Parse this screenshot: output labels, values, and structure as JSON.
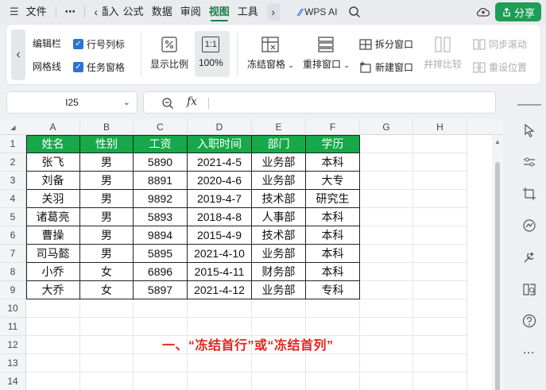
{
  "menubar": {
    "hamburger": "☰",
    "file": "文件",
    "more": "⋯",
    "tabs": [
      "插入",
      "公式",
      "数据",
      "审阅",
      "视图",
      "工具"
    ],
    "active_tab": "视图",
    "wps_ai": "WPS AI",
    "share": "分享"
  },
  "ribbon": {
    "edit_bar": "编辑栏",
    "gridlines": "网格线",
    "row_col_headers": "行号列标",
    "task_pane": "任务窗格",
    "zoom_display": "显示比例",
    "zoom_icon": "1:1",
    "zoom_100": "100%",
    "freeze_panes": "冻结窗格",
    "rearrange": "重排窗口",
    "split": "拆分窗口",
    "new_window": "新建窗口",
    "side_by_side": "并排比较",
    "sync_scroll": "同步滚动",
    "reset_position": "重设位置"
  },
  "formula_bar": {
    "name_box": "I25",
    "fx": "fx",
    "value": ""
  },
  "sheet": {
    "columns": [
      "A",
      "B",
      "C",
      "D",
      "E",
      "F",
      "G",
      "H"
    ],
    "rows": [
      "1",
      "2",
      "3",
      "4",
      "5",
      "6",
      "7",
      "8",
      "9",
      "10",
      "11",
      "12",
      "13",
      "14"
    ],
    "table": {
      "headers": [
        "姓名",
        "性别",
        "工资",
        "入职时间",
        "部门",
        "学历"
      ],
      "rows": [
        [
          "张飞",
          "男",
          "5890",
          "2021-4-5",
          "业务部",
          "本科"
        ],
        [
          "刘备",
          "男",
          "8891",
          "2020-4-6",
          "业务部",
          "大专"
        ],
        [
          "关羽",
          "男",
          "9892",
          "2019-4-7",
          "技术部",
          "研究生"
        ],
        [
          "诸葛亮",
          "男",
          "5893",
          "2018-4-8",
          "人事部",
          "本科"
        ],
        [
          "曹操",
          "男",
          "9894",
          "2015-4-9",
          "技术部",
          "本科"
        ],
        [
          "司马懿",
          "男",
          "5895",
          "2021-4-10",
          "业务部",
          "本科"
        ],
        [
          "小乔",
          "女",
          "6896",
          "2015-4-11",
          "财务部",
          "本科"
        ],
        [
          "大乔",
          "女",
          "5897",
          "2021-4-12",
          "业务部",
          "专科"
        ]
      ]
    },
    "caption": "一、“冻结首行”或“冻结首列”"
  },
  "colors": {
    "accent": "#1a7f4b",
    "header_fill": "#17a84a",
    "caption": "#e0251b",
    "share_button": "#1f9d55",
    "checkbox": "#2a74d8"
  }
}
